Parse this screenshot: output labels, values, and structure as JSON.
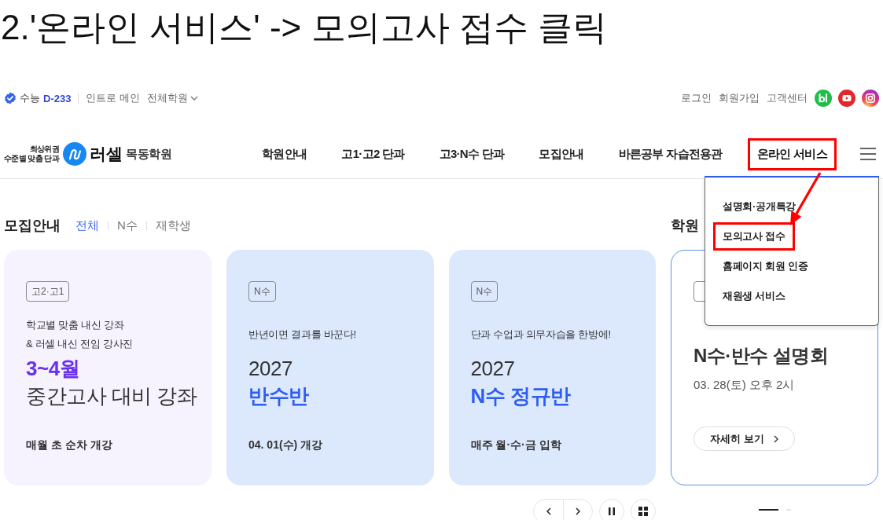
{
  "caption": "2.'온라인 서비스' -> 모의고사 접수 클릭",
  "top_bar": {
    "exam_label": "수능",
    "dday": "D-233",
    "links": [
      {
        "label": "인트로 메인",
        "dropdown": false
      },
      {
        "label": "전체학원",
        "dropdown": true
      }
    ],
    "account_links": [
      "로그인",
      "회원가입",
      "고객센터"
    ],
    "social": [
      {
        "kind": "blog"
      },
      {
        "kind": "youtube"
      },
      {
        "kind": "instagram"
      }
    ]
  },
  "header": {
    "logo": {
      "tagline": [
        "최상위권",
        "수준별 맞춤 단과"
      ],
      "brand": "러셀",
      "branch": "목동학원"
    },
    "nav": [
      {
        "label": "학원안내",
        "expanded": false,
        "callout": false
      },
      {
        "label": "고1·고2 단과",
        "expanded": false,
        "callout": false
      },
      {
        "label": "고3·N수 단과",
        "expanded": false,
        "callout": false
      },
      {
        "label": "모집안내",
        "expanded": false,
        "callout": false
      },
      {
        "label": "바른공부 자습전용관",
        "expanded": false,
        "callout": false
      },
      {
        "label": "온라인 서비스",
        "expanded": true,
        "callout": true,
        "submenu": [
          {
            "label": "설명회·공개특강",
            "callout": false
          },
          {
            "label": "모의고사 접수",
            "callout": true
          },
          {
            "label": "홈페이지 회원 인증",
            "callout": false
          },
          {
            "label": "재원생 서비스",
            "callout": false
          }
        ]
      }
    ]
  },
  "callout_arrow": true,
  "sections": [
    {
      "title": "모집안내",
      "filters": [
        {
          "label": "전체",
          "selected": true
        },
        {
          "label": "N수",
          "selected": false
        },
        {
          "label": "재학생",
          "selected": false
        }
      ],
      "cards": [
        {
          "kind": "course",
          "color": "#f6f3fe",
          "tag": "고2·고1",
          "description": [
            "학교별 맞춤 내신 강좌",
            "& 러셀 내신 전임 강사진"
          ],
          "lines": [
            {
              "text": "3~4월",
              "emphasis": true,
              "color": "#6a30f2"
            },
            {
              "text": "중간고사 대비 강좌",
              "emphasis": false
            }
          ],
          "footer": "매월 초 순차 개강"
        },
        {
          "kind": "course",
          "color": "#dce9fd",
          "tag": "N수",
          "description": [
            "반년이면 결과를 바꾼다!"
          ],
          "lines": [
            {
              "text": "2027",
              "emphasis": false
            },
            {
              "text": "반수반",
              "emphasis": true,
              "color": "#2f5cf3"
            }
          ],
          "footer": "04. 01(수) 개강"
        },
        {
          "kind": "course",
          "color": "#dce9fd",
          "tag": "N수",
          "description": [
            "단과 수업과 의무자습을 한방에!"
          ],
          "lines": [
            {
              "text": "2027",
              "emphasis": false
            },
            {
              "text": "N수 정규반",
              "emphasis": true,
              "color": "#2f5cf3"
            }
          ],
          "footer": "매주 월·수·금 입학"
        }
      ],
      "carousel": [
        {
          "kind": "prev"
        },
        {
          "kind": "next"
        },
        {
          "kind": "pause"
        },
        {
          "kind": "grid"
        }
      ]
    },
    {
      "title": "학원",
      "cards": [
        {
          "kind": "event",
          "title": "N수·반수 설명회",
          "date": "03. 28(토) 오후 2시",
          "button": "자세히 보기"
        }
      ],
      "pagination": [
        {
          "selected": true
        },
        {
          "selected": false
        }
      ]
    }
  ]
}
